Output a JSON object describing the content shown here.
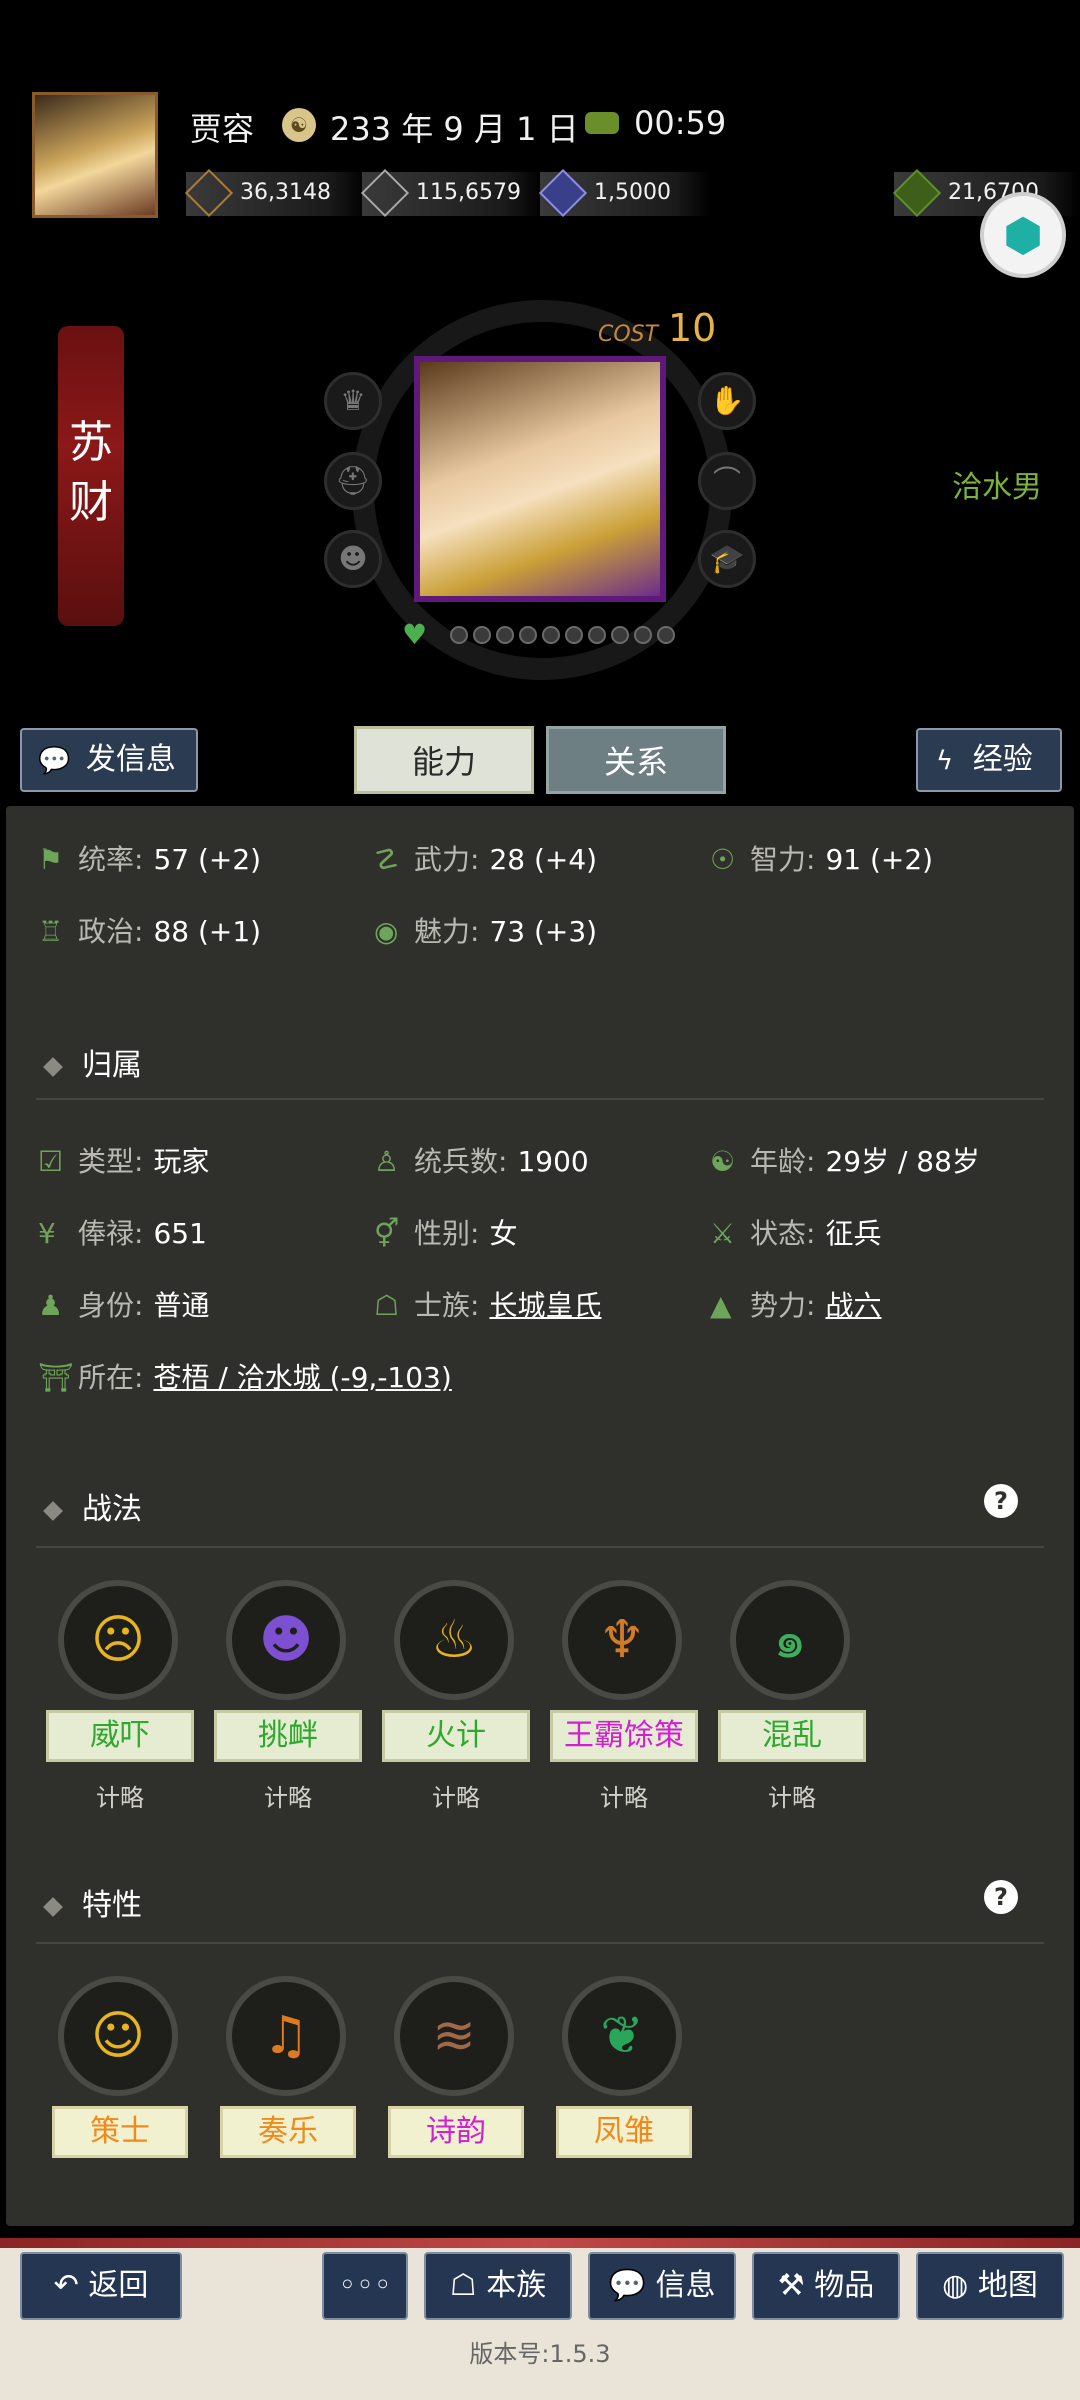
{
  "header": {
    "player_name": "贾容",
    "date": "233 年 9 月 1 日",
    "time": "00:59",
    "resources": [
      {
        "name": "money",
        "icon": "coin-icon",
        "value": "36,3148"
      },
      {
        "name": "food",
        "icon": "grain-icon",
        "value": "115,6579"
      },
      {
        "name": "troops",
        "icon": "soldier-icon",
        "value": "1,5000"
      },
      {
        "name": "gold",
        "icon": "moneybag-icon",
        "value": "21,6700"
      }
    ]
  },
  "character": {
    "name_char1": "苏",
    "name_char2": "财",
    "cost_label": "COST",
    "cost": "10",
    "location_right": "洽水男"
  },
  "actions": {
    "message": "发信息",
    "tab_ability": "能力",
    "tab_relation": "关系",
    "experience": "经验"
  },
  "stats": [
    {
      "label": "统率:",
      "value": "57 (+2)"
    },
    {
      "label": "武力:",
      "value": "28 (+4)"
    },
    {
      "label": "智力:",
      "value": "91 (+2)"
    },
    {
      "label": "政治:",
      "value": "88 (+1)"
    },
    {
      "label": "魅力:",
      "value": "73 (+3)"
    }
  ],
  "affiliation": {
    "title": "归属",
    "type_label": "类型:",
    "type_value": "玩家",
    "troops_label": "统兵数:",
    "troops_value": "1900",
    "age_label": "年龄:",
    "age_value": "29岁 / 88岁",
    "salary_label": "俸禄:",
    "salary_value": "651",
    "gender_label": "性别:",
    "gender_value": "女",
    "status_label": "状态:",
    "status_value": "征兵",
    "identity_label": "身份:",
    "identity_value": "普通",
    "clan_label": "士族:",
    "clan_value": "长城皇氏",
    "force_label": "势力:",
    "force_value": "战六",
    "location_label": "所在:",
    "location_value": "苍梧 / 洽水城 (-9,-103)"
  },
  "tactics": {
    "title": "战法",
    "items": [
      {
        "name": "威吓",
        "type": "计略",
        "color": "#2fa82f",
        "icon_color": "#e6b520"
      },
      {
        "name": "挑衅",
        "type": "计略",
        "color": "#2fa82f",
        "icon_color": "#7d4fd1"
      },
      {
        "name": "火计",
        "type": "计略",
        "color": "#2fa82f",
        "icon_color": "#e6b520"
      },
      {
        "name": "王霸馀策",
        "type": "计略",
        "color": "#d21fd2",
        "icon_color": "#d07a2a"
      },
      {
        "name": "混乱",
        "type": "计略",
        "color": "#2fa82f",
        "icon_color": "#3fae5c"
      }
    ]
  },
  "traits": {
    "title": "特性",
    "items": [
      {
        "name": "策士",
        "color": "#f08a1a",
        "icon_color": "#e6b520"
      },
      {
        "name": "奏乐",
        "color": "#f08a1a",
        "icon_color": "#e07a20"
      },
      {
        "name": "诗韵",
        "color": "#d21fd2",
        "icon_color": "#a06a4a"
      },
      {
        "name": "凤雏",
        "color": "#f08a1a",
        "icon_color": "#2aa65a"
      }
    ]
  },
  "bottom_nav": {
    "back": "返回",
    "more": "◦◦◦",
    "clan": "本族",
    "info": "信息",
    "items": "物品",
    "map": "地图",
    "version": "版本号:1.5.3"
  }
}
